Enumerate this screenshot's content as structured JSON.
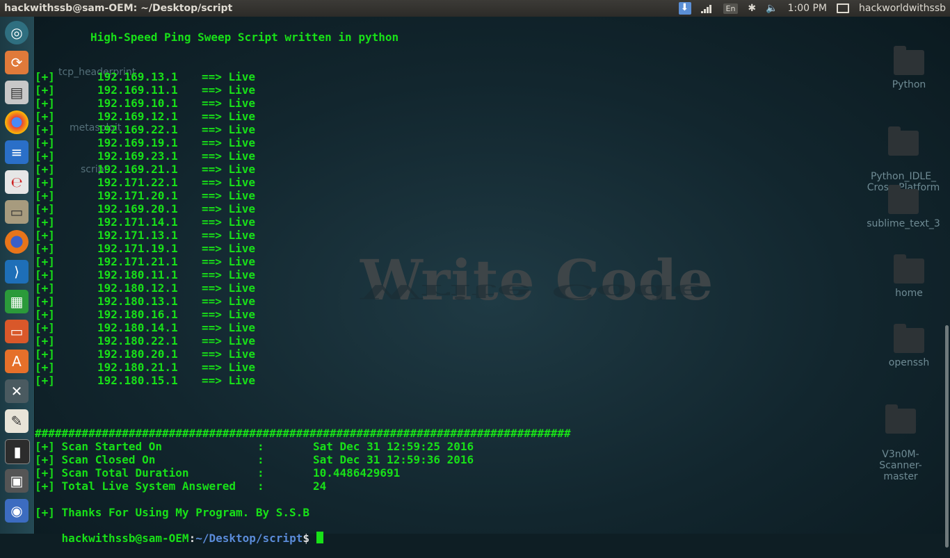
{
  "top_panel": {
    "title": "hackwithssb@sam-OEM: ~/Desktop/script",
    "lang": "En",
    "time": "1:00 PM",
    "user": "hackworldwithssb"
  },
  "launcher": {
    "icons": [
      "ubuntu-dash-icon",
      "software-updater-icon",
      "file-cabinet-icon",
      "chrome-icon",
      "libreoffice-writer-icon",
      "pdf-reader-icon",
      "files-icon",
      "firefox-icon",
      "vscode-icon",
      "libreoffice-calc-icon",
      "libreoffice-impress-icon",
      "software-center-icon",
      "system-settings-icon",
      "text-editor-icon",
      "terminal-icon",
      "workspace-icon",
      "disk-icon",
      "trash-icon"
    ]
  },
  "desktop": {
    "wallpaper_text": "Write Code",
    "icons_right": [
      {
        "label": "Python"
      },
      {
        "label": "Python_IDLE_\nCross_Platform"
      },
      {
        "label": "sublime_text_3"
      },
      {
        "label": "home"
      },
      {
        "label": "openssh"
      },
      {
        "label": "V3n0M-Scanner-\nmaster"
      }
    ],
    "icons_left": [
      {
        "label": "tcp_headerprint"
      },
      {
        "label": "metasploit"
      },
      {
        "label": "script"
      }
    ]
  },
  "terminal": {
    "header": "High-Speed Ping Sweep Script written in python",
    "results": [
      {
        "tag": "[+]",
        "ip": "192.169.13.1",
        "status": "==> Live"
      },
      {
        "tag": "[+]",
        "ip": "192.169.11.1",
        "status": "==> Live"
      },
      {
        "tag": "[+]",
        "ip": "192.169.10.1",
        "status": "==> Live"
      },
      {
        "tag": "[+]",
        "ip": "192.169.12.1",
        "status": "==> Live"
      },
      {
        "tag": "[+]",
        "ip": "192.169.22.1",
        "status": "==> Live"
      },
      {
        "tag": "[+]",
        "ip": "192.169.19.1",
        "status": "==> Live"
      },
      {
        "tag": "[+]",
        "ip": "192.169.23.1",
        "status": "==> Live"
      },
      {
        "tag": "[+]",
        "ip": "192.169.21.1",
        "status": "==> Live"
      },
      {
        "tag": "[+]",
        "ip": "192.171.22.1",
        "status": "==> Live"
      },
      {
        "tag": "[+]",
        "ip": "192.171.20.1",
        "status": "==> Live"
      },
      {
        "tag": "[+]",
        "ip": "192.169.20.1",
        "status": "==> Live"
      },
      {
        "tag": "[+]",
        "ip": "192.171.14.1",
        "status": "==> Live"
      },
      {
        "tag": "[+]",
        "ip": "192.171.13.1",
        "status": "==> Live"
      },
      {
        "tag": "[+]",
        "ip": "192.171.19.1",
        "status": "==> Live"
      },
      {
        "tag": "[+]",
        "ip": "192.171.21.1",
        "status": "==> Live"
      },
      {
        "tag": "[+]",
        "ip": "192.180.11.1",
        "status": "==> Live"
      },
      {
        "tag": "[+]",
        "ip": "192.180.12.1",
        "status": "==> Live"
      },
      {
        "tag": "[+]",
        "ip": "192.180.13.1",
        "status": "==> Live"
      },
      {
        "tag": "[+]",
        "ip": "192.180.16.1",
        "status": "==> Live"
      },
      {
        "tag": "[+]",
        "ip": "192.180.14.1",
        "status": "==> Live"
      },
      {
        "tag": "[+]",
        "ip": "192.180.22.1",
        "status": "==> Live"
      },
      {
        "tag": "[+]",
        "ip": "192.180.20.1",
        "status": "==> Live"
      },
      {
        "tag": "[+]",
        "ip": "192.180.21.1",
        "status": "==> Live"
      },
      {
        "tag": "[+]",
        "ip": "192.180.15.1",
        "status": "==> Live"
      }
    ],
    "separator": "################################################################################",
    "summary": [
      {
        "label": "[+] Scan Started On",
        "value": "Sat Dec 31 12:59:25 2016"
      },
      {
        "label": "[+] Scan Closed On",
        "value": "Sat Dec 31 12:59:36 2016"
      },
      {
        "label": "[+] Scan Total Duration",
        "value": "10.4486429691"
      },
      {
        "label": "[+] Total Live System Answered",
        "value": "24"
      }
    ],
    "colon": ":",
    "thanks": "[+] Thanks For Using My Program. By S.S.B",
    "prompt_user": "hackwithssb@sam-OEM",
    "prompt_sep": ":",
    "prompt_path": "~/Desktop/script",
    "prompt_symbol": "$ "
  },
  "colors": {
    "terminal_green": "#18e018",
    "path_blue": "#5a8bd8",
    "panel_bg": "#3c3b37"
  }
}
